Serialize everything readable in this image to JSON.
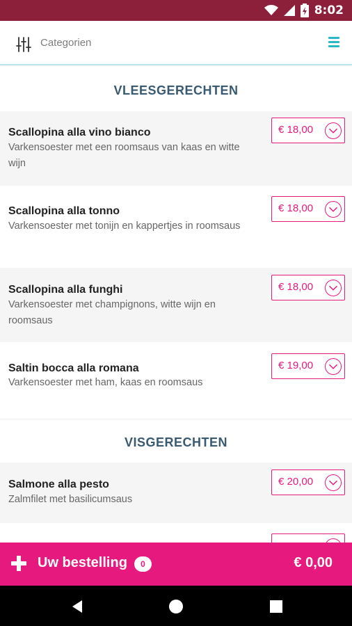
{
  "status": {
    "time": "8:02"
  },
  "header": {
    "categories_label": "Categorien"
  },
  "sections": [
    {
      "title": "VLEESGERECHTEN",
      "items": [
        {
          "name": "Scallopina alla vino bianco",
          "desc": "Varkensoester met een roomsaus van kaas en witte wijn",
          "price": "€ 18,00"
        },
        {
          "name": "Scallopina alla tonno",
          "desc": "Varkensoester met tonijn en kappertjes in roomsaus",
          "price": "€ 18,00"
        },
        {
          "name": "Scallopina alla funghi",
          "desc": "Varkensoester met champignons, witte wijn en roomsaus",
          "price": "€ 18,00"
        },
        {
          "name": "Saltin bocca alla romana",
          "desc": "Varkensoester met ham, kaas en roomsaus",
          "price": "€ 19,00"
        }
      ]
    },
    {
      "title": "VISGERECHTEN",
      "items": [
        {
          "name": "Salmone alla pesto",
          "desc": "Zalmfilet met basilicumsaus",
          "price": "€ 20,00"
        }
      ]
    }
  ],
  "order": {
    "label": "Uw bestelling",
    "count": "0",
    "total": "€ 0,00"
  },
  "colors": {
    "accent": "#e5197e",
    "header_teal": "#2db6c9",
    "statusbar": "#8c1f3a",
    "section_title": "#3a5a72"
  },
  "icons": [
    "wifi-icon",
    "signal-icon",
    "battery-icon",
    "filter-icon",
    "menu-icon",
    "chevron-down-icon",
    "plus-icon",
    "back-icon",
    "home-icon",
    "recents-icon"
  ]
}
